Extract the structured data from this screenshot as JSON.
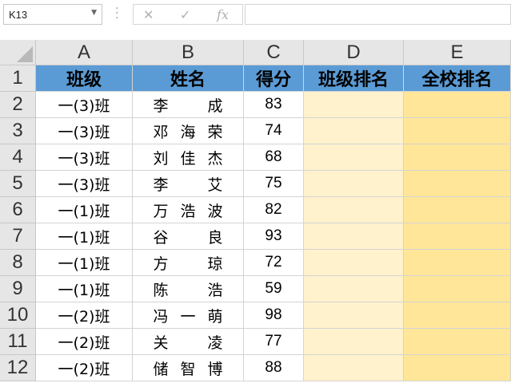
{
  "name_box": "K13",
  "formula": "",
  "columns": [
    "A",
    "B",
    "C",
    "D",
    "E"
  ],
  "rows": [
    "1",
    "2",
    "3",
    "4",
    "5",
    "6",
    "7",
    "8",
    "9",
    "10",
    "11",
    "12"
  ],
  "headers": [
    "班级",
    "姓名",
    "得分",
    "班级排名",
    "全校排名"
  ],
  "data": [
    [
      "一(3)班",
      [
        "李",
        "",
        "成"
      ],
      "83"
    ],
    [
      "一(3)班",
      [
        "邓",
        "海",
        "荣"
      ],
      "74"
    ],
    [
      "一(3)班",
      [
        "刘",
        "佳",
        "杰"
      ],
      "68"
    ],
    [
      "一(3)班",
      [
        "李",
        "",
        "艾"
      ],
      "75"
    ],
    [
      "一(1)班",
      [
        "万",
        "浩",
        "波"
      ],
      "82"
    ],
    [
      "一(1)班",
      [
        "谷",
        "",
        "良"
      ],
      "93"
    ],
    [
      "一(1)班",
      [
        "方",
        "",
        "琼"
      ],
      "72"
    ],
    [
      "一(1)班",
      [
        "陈",
        "",
        "浩"
      ],
      "59"
    ],
    [
      "一(2)班",
      [
        "冯",
        "一",
        "萌"
      ],
      "98"
    ],
    [
      "一(2)班",
      [
        "关",
        "",
        "凌"
      ],
      "77"
    ],
    [
      "一(2)班",
      [
        "储",
        "智",
        "博"
      ],
      "88"
    ]
  ],
  "colors": {
    "header_fill": "#5b9bd5",
    "rank_class_fill": "#fff2cc",
    "rank_school_fill": "#ffe699"
  }
}
